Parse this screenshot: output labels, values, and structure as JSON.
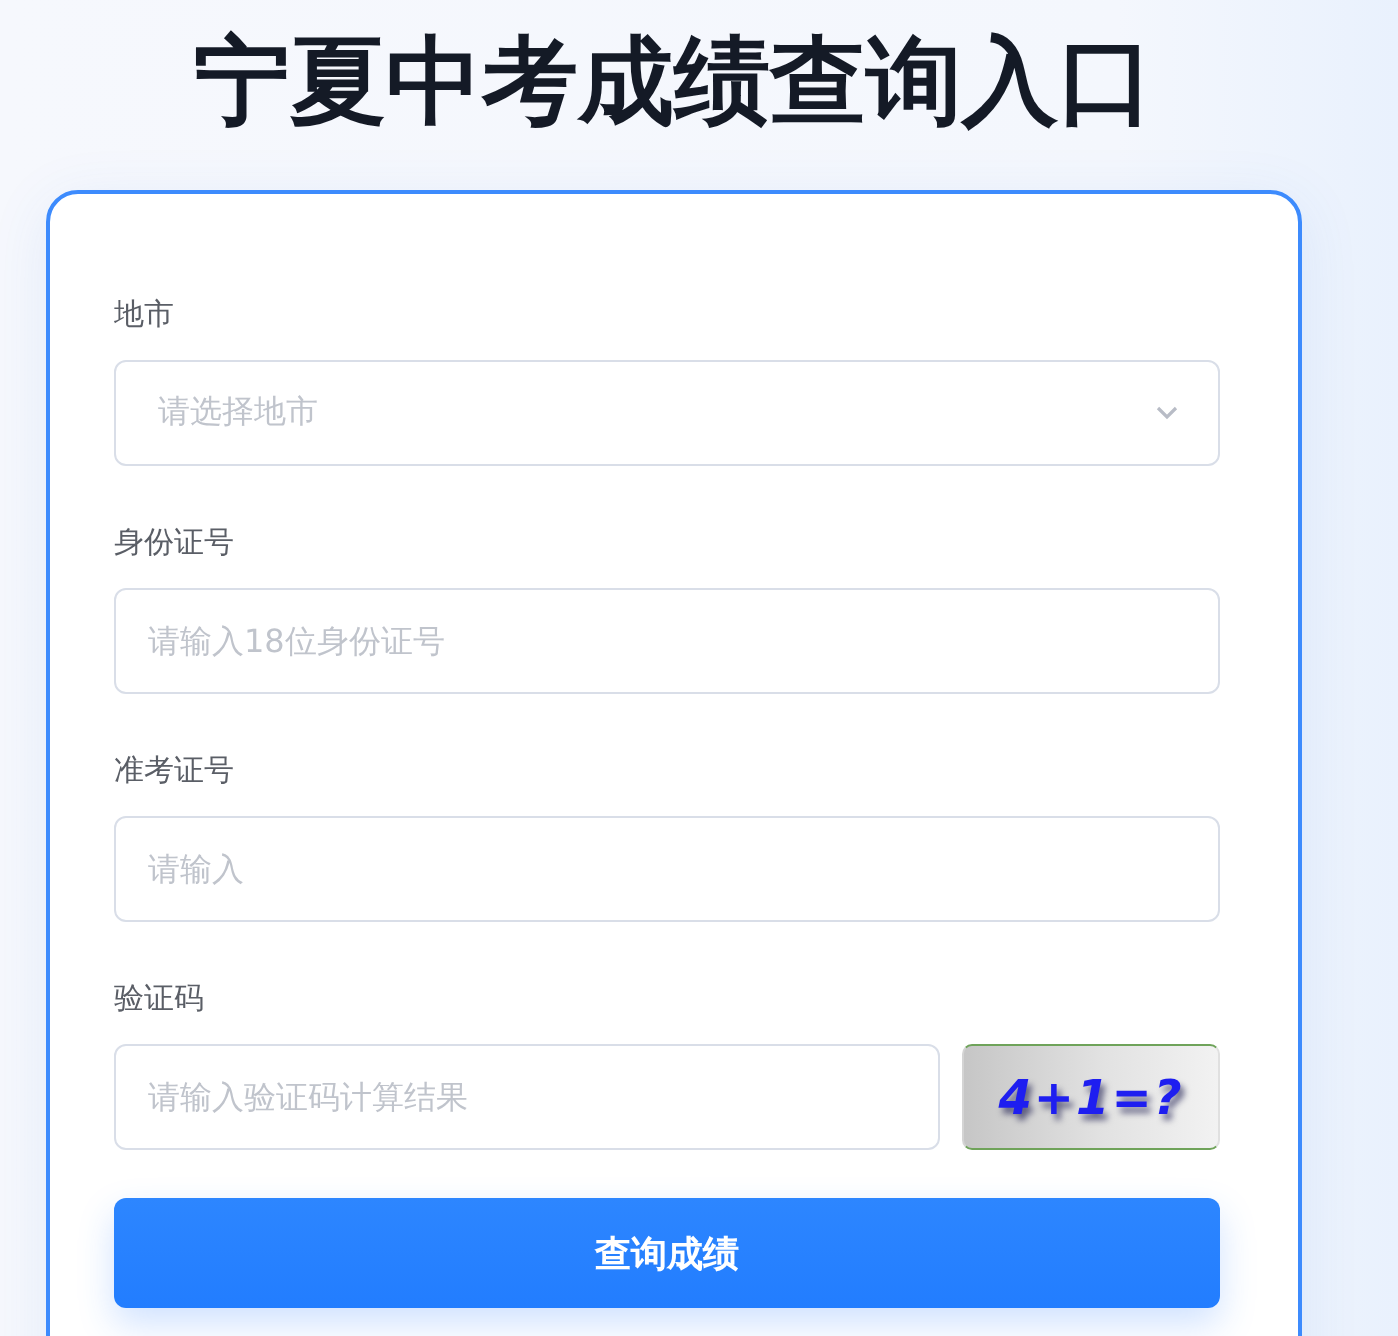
{
  "title": "宁夏中考成绩查询入口",
  "form": {
    "fields": [
      {
        "kind": "select",
        "label": "地市",
        "placeholder": "请选择地市"
      },
      {
        "kind": "text",
        "label": "身份证号",
        "placeholder": "请输入18位身份证号"
      },
      {
        "kind": "text",
        "label": "准考证号",
        "placeholder": "请输入"
      },
      {
        "kind": "captcha",
        "label": "验证码",
        "placeholder": "请输入验证码计算结果",
        "captcha_text": "4+1=?"
      }
    ],
    "submit_button": "查询成绩"
  }
}
